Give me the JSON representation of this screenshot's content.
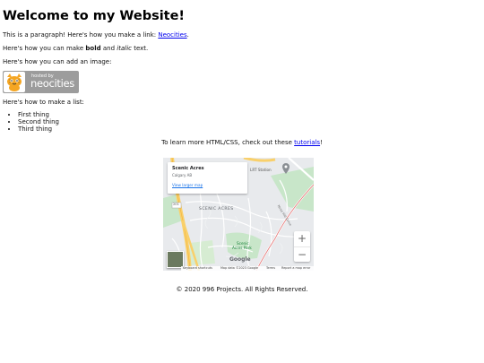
{
  "heading": "Welcome to my Website!",
  "intro": {
    "text": "This is a paragraph! Here's how you make a link: ",
    "link_label": "Neocities",
    "end": "."
  },
  "formatting": {
    "before": "Here's how you can make ",
    "bold": "bold",
    "middle": " and ",
    "italic": "italic",
    "after": " text."
  },
  "image_line": "Here's how you can add an image:",
  "badge": {
    "hosted_by": "hosted by",
    "brand": "neocities",
    "icon": "neocities-cat-logo"
  },
  "list_intro": "Here's how to make a list:",
  "list_items": [
    "First thing",
    "Second thing",
    "Third thing"
  ],
  "learn_more": {
    "text": "To learn more HTML/CSS, check out these ",
    "link_label": "tutorials",
    "end": "!"
  },
  "map": {
    "place_name": "Scenic Acres",
    "place_sub": "Calgary AB",
    "larger_map": "View larger map",
    "labels": {
      "lrt_station": "LRT Station",
      "neighbourhood": "SCENIC ACRES",
      "park_line1": "Scenic",
      "park_line2": "Acres Park",
      "road": "Nose Hill Drive",
      "route": "201"
    },
    "zoom_in": "+",
    "zoom_out": "−",
    "google": "Google",
    "attribution": {
      "shortcuts": "Keyboard shortcuts",
      "data": "Map data ©2023 Google",
      "terms": "Terms",
      "report": "Report a map error"
    },
    "colors": {
      "land": "#e8eaed",
      "park": "#c8e6c9",
      "highway": "#f9d06b",
      "road": "#ffffff",
      "rail": "#e57373",
      "route": "#b8b8b8"
    }
  },
  "footer": "© 2020 996 Projects. All Rights Reserved."
}
